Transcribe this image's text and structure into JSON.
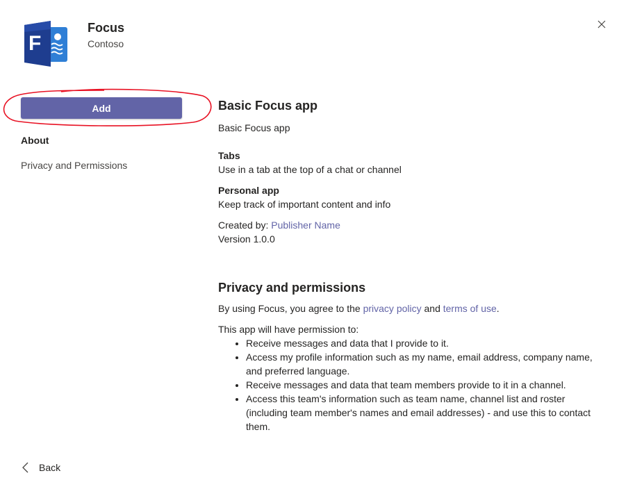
{
  "app": {
    "name": "Focus",
    "publisher": "Contoso",
    "logo_letter": "F"
  },
  "actions": {
    "add_label": "Add",
    "back_label": "Back"
  },
  "nav": {
    "about": "About",
    "privacy": "Privacy and Permissions"
  },
  "about": {
    "title": "Basic Focus app",
    "description": "Basic Focus app",
    "tabs_heading": "Tabs",
    "tabs_desc": "Use in a tab at the top of a chat or channel",
    "personal_heading": "Personal app",
    "personal_desc": "Keep track of important content and info",
    "created_by_prefix": "Created by: ",
    "publisher_link": "Publisher Name",
    "version": "Version 1.0.0"
  },
  "privacy": {
    "title": "Privacy and permissions",
    "agree_prefix": "By using Focus, you agree to the ",
    "privacy_policy_link": "privacy policy",
    "and_text": " and ",
    "terms_link": "terms of use",
    "period": ".",
    "permission_intro": "This app will have permission to:",
    "permissions": [
      "Receive messages and data that I provide to it.",
      "Access my profile information such as my name, email address, company name, and preferred language.",
      "Receive messages and data that team members provide to it in a channel.",
      "Access this team's information such as team name, channel list and roster (including team member's names and email addresses) - and use this to contact them."
    ]
  },
  "colors": {
    "accent": "#6264a7",
    "logo_dark": "#1e3d8f",
    "logo_light": "#2f7fd6",
    "annotation": "#e81123"
  }
}
